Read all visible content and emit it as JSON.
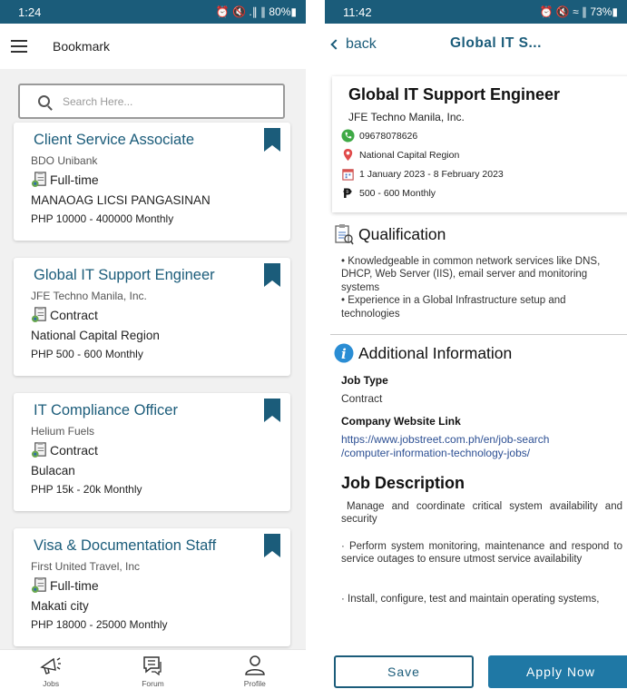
{
  "left": {
    "status": {
      "time": "1:24",
      "icons": "⏰ 🔇 .∥ ∥ 80%▮"
    },
    "appbar": {
      "title": "Bookmark"
    },
    "search": {
      "placeholder": "Search Here..."
    },
    "jobs": [
      {
        "title": "Client Service Associate",
        "company": "BDO Unibank",
        "type": "Full-time",
        "location": "MANAOAG LICSI PANGASINAN",
        "salary": "PHP 10000 - 400000 Monthly"
      },
      {
        "title": "Global IT Support Engineer",
        "company": "JFE Techno Manila, Inc.",
        "type": "Contract",
        "location": "National Capital Region",
        "salary": "PHP 500 - 600 Monthly"
      },
      {
        "title": "IT Compliance Officer",
        "company": "Helium Fuels",
        "type": "Contract",
        "location": "Bulacan",
        "salary": "PHP 15k - 20k Monthly"
      },
      {
        "title": "Visa & Documentation Staff",
        "company": "First United Travel, Inc",
        "type": "Full-time",
        "location": "Makati city",
        "salary": "PHP 18000 - 25000 Monthly"
      }
    ],
    "nav": [
      {
        "label": "Jobs",
        "icon": "megaphone-icon"
      },
      {
        "label": "Forum",
        "icon": "chat-icon"
      },
      {
        "label": "Profile",
        "icon": "profile-icon"
      }
    ]
  },
  "right": {
    "status": {
      "time": "11:42",
      "icons": "⏰ 🔇 ≈ ∥ 73%▮"
    },
    "appbar": {
      "back_label": "back",
      "title": "Global IT S..."
    },
    "job": {
      "title": "Global IT Support Engineer",
      "company": "JFE Techno Manila, Inc.",
      "phone": "09678078626",
      "location": "National Capital Region",
      "dates": "1 January 2023 - 8 February 2023",
      "salary": "500 - 600 Monthly"
    },
    "qualification": {
      "heading": "Qualification",
      "text": "• Knowledgeable in common network services like DNS, DHCP, Web Server (IIS), email server and monitoring systems\n• Experience in a Global Infrastructure setup and technologies"
    },
    "additional": {
      "heading": "Additional Information",
      "job_type_label": "Job Type",
      "job_type": "Contract",
      "website_label": "Company Website Link",
      "website": "https://www.jobstreet.com.ph/en/job-search\n/computer-information-technology-jobs/"
    },
    "description": {
      "heading": "Job Description",
      "p1": "Manage and coordinate critical system availability and security",
      "p2": "·          Perform system monitoring, maintenance and respond to service outages to ensure utmost service availability",
      "p3": "·          Install, configure, test and maintain operating systems,"
    },
    "buttons": {
      "save": "Save",
      "apply": "Apply Now"
    },
    "colors": {
      "brand": "#1b5c7a",
      "apply": "#1f78a5",
      "link": "#2c4f93"
    }
  }
}
